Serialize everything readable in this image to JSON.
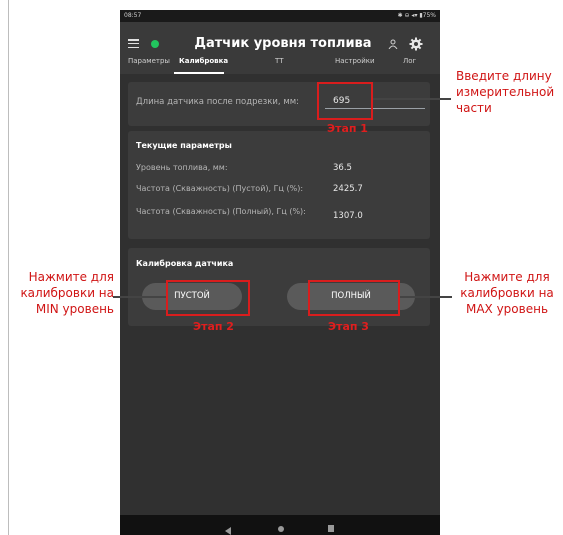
{
  "status_bar": {
    "time": "08:57",
    "right": "✱ ⊖ ◂▾ ▮75%"
  },
  "app": {
    "title": "Датчик уровня топлива",
    "tabs": [
      "Параметры",
      "Калибровка",
      "ТТ",
      "Настройки",
      "Лог"
    ],
    "active_tab": "Калибровка"
  },
  "sensor_length": {
    "label": "Длина датчика после подрезки, мм:",
    "value": "695"
  },
  "current_params": {
    "title": "Текущие параметры",
    "rows": [
      {
        "label": "Уровень топлива, мм:",
        "value": "36.5"
      },
      {
        "label": "Частота (Скважность) (Пустой), Гц (%):",
        "value": "2425.7"
      },
      {
        "label": "Частота (Скважность) (Полный), Гц (%):",
        "value": "1307.0"
      }
    ]
  },
  "calibration": {
    "title": "Калибровка датчика",
    "empty_button": "ПУСТОЙ",
    "full_button": "ПОЛНЫЙ"
  },
  "annotations": {
    "step1": "Этап 1",
    "step2": "Этап 2",
    "step3": "Этап 3",
    "note_length": "Введите длину измерительной части",
    "note_min": "Нажмите для калибровки на MIN уровень",
    "note_max": "Нажмите для калибровки на MAX уровень",
    "color": "#d91d1d"
  },
  "colors": {
    "screen_bg": "#303030",
    "card_bg": "#3c3c3c",
    "button_bg": "#5a5a5a",
    "status_dot": "#22c55e"
  }
}
